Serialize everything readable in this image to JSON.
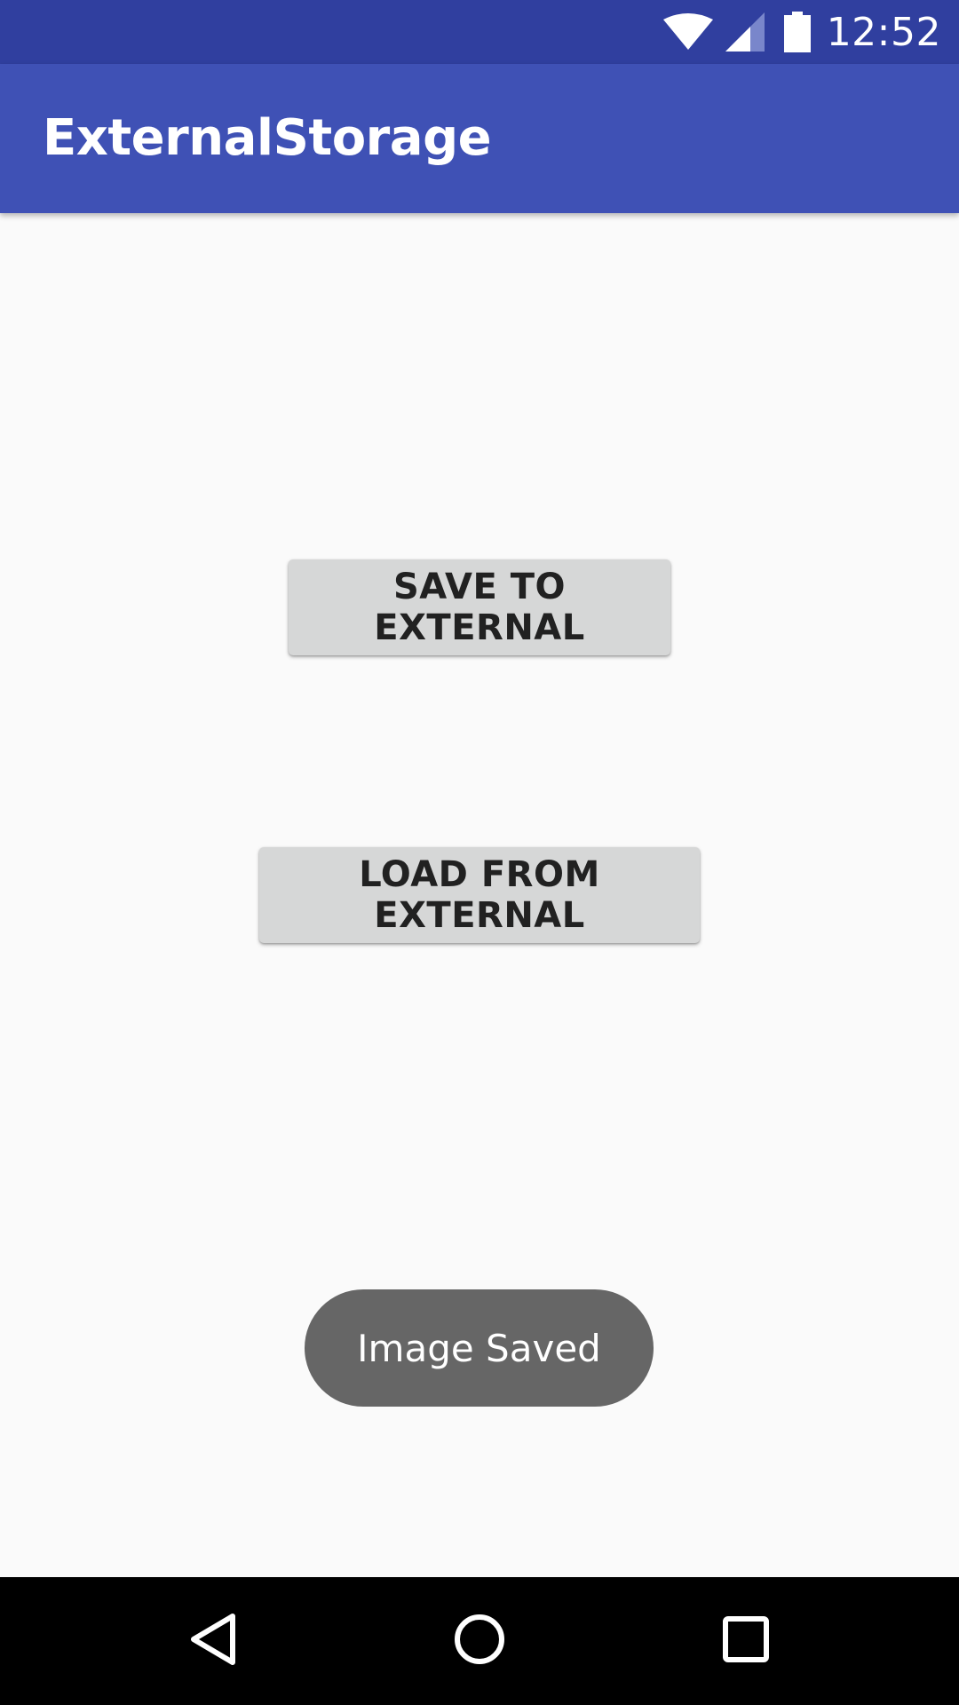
{
  "status_bar": {
    "time": "12:52",
    "icons": [
      "wifi-icon",
      "signal-icon",
      "battery-icon"
    ]
  },
  "app_bar": {
    "title": "ExternalStorage"
  },
  "main": {
    "save_button_label": "SAVE TO EXTERNAL",
    "load_button_label": "LOAD FROM EXTERNAL"
  },
  "toast": {
    "message": "Image Saved"
  },
  "nav_bar": {
    "icons": [
      "back-icon",
      "home-icon",
      "recents-icon"
    ]
  },
  "colors": {
    "status_bar": "#303f9f",
    "app_bar": "#3f51b5",
    "background": "#fafafa",
    "button": "#d6d7d7",
    "toast": "#666666"
  }
}
